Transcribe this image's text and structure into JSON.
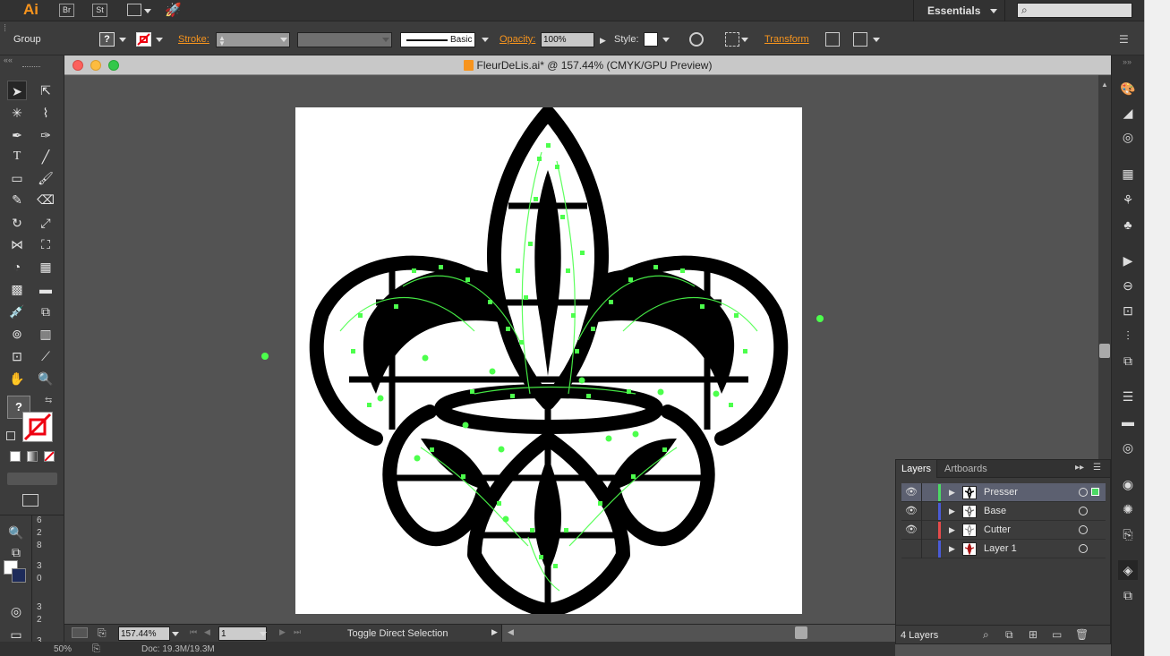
{
  "app": {
    "logo": "Ai",
    "bridge": "Br",
    "stock": "St",
    "workspace": "Essentials",
    "search_placeholder": ""
  },
  "control": {
    "selection": "Group",
    "fill_symbol": "?",
    "stroke_label": "Stroke:",
    "brush_label": "Basic",
    "opacity_label": "Opacity:",
    "opacity_value": "100%",
    "style_label": "Style:",
    "transform_label": "Transform"
  },
  "document": {
    "title": "FleurDeLis.ai* @ 157.44% (CMYK/GPU Preview)"
  },
  "tools": {
    "fill_question": "?",
    "type_tool": "T"
  },
  "status": {
    "zoom": "157.44%",
    "artboard": "1",
    "tool_hint": "Toggle Direct Selection"
  },
  "bottom": {
    "zoom": "50%",
    "doc_info": "Doc: 19.3M/19.3M"
  },
  "ruler": {
    "numbers": [
      "6",
      "2",
      "8",
      "3",
      "0",
      "3",
      "2",
      "3"
    ]
  },
  "layers_panel": {
    "tab_layers": "Layers",
    "tab_artboards": "Artboards",
    "count": "4 Layers",
    "rows": [
      {
        "name": "Presser",
        "color": "#4cd964",
        "visible": true,
        "selected": true
      },
      {
        "name": "Base",
        "color": "#4a5bd6",
        "visible": true,
        "selected": false
      },
      {
        "name": "Cutter",
        "color": "#e54b4b",
        "visible": true,
        "selected": false
      },
      {
        "name": "Layer 1",
        "color": "#4a5bd6",
        "visible": false,
        "selected": false
      }
    ]
  },
  "colors": {
    "accent": "#f7941d",
    "selection_green": "#4cff4c"
  }
}
